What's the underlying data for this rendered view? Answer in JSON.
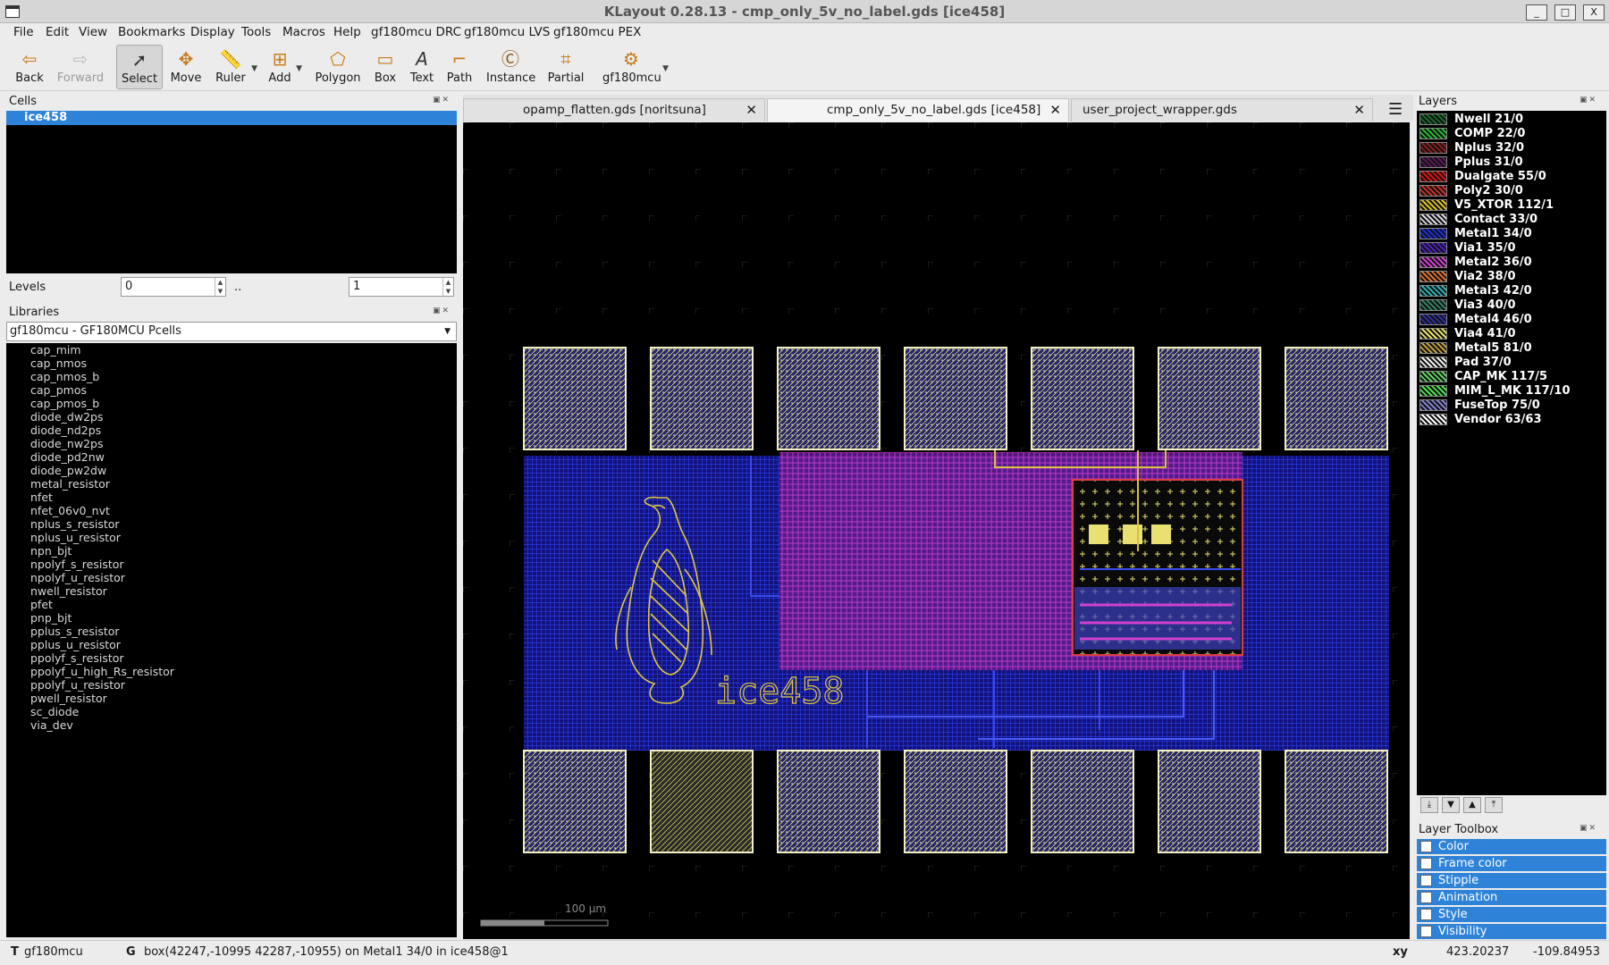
{
  "window": {
    "title": "KLayout 0.28.13 - cmp_only_5v_no_label.gds [ice458]"
  },
  "menu": [
    "File",
    "Edit",
    "View",
    "Bookmarks",
    "Display",
    "Tools",
    "Macros",
    "Help",
    "gf180mcu DRC",
    "gf180mcu LVS",
    "gf180mcu PEX"
  ],
  "toolbar": {
    "back": "Back",
    "forward": "Forward",
    "select": "Select",
    "move": "Move",
    "ruler": "Ruler",
    "add": "Add",
    "polygon": "Polygon",
    "box": "Box",
    "text": "Text",
    "path": "Path",
    "instance": "Instance",
    "partial": "Partial",
    "pdk": "gf180mcu"
  },
  "cells": {
    "title": "Cells",
    "selected": "ice458"
  },
  "levels": {
    "label": "Levels",
    "from": "0",
    "sep": "..",
    "to": "1"
  },
  "libraries": {
    "title": "Libraries",
    "selected": "gf180mcu - GF180MCU Pcells",
    "items": [
      "cap_mim",
      "cap_nmos",
      "cap_nmos_b",
      "cap_pmos",
      "cap_pmos_b",
      "diode_dw2ps",
      "diode_nd2ps",
      "diode_nw2ps",
      "diode_pd2nw",
      "diode_pw2dw",
      "metal_resistor",
      "nfet",
      "nfet_06v0_nvt",
      "nplus_s_resistor",
      "nplus_u_resistor",
      "npn_bjt",
      "npolyf_s_resistor",
      "npolyf_u_resistor",
      "nwell_resistor",
      "pfet",
      "pnp_bjt",
      "pplus_s_resistor",
      "pplus_u_resistor",
      "ppolyf_s_resistor",
      "ppolyf_u_high_Rs_resistor",
      "ppolyf_u_resistor",
      "pwell_resistor",
      "sc_diode",
      "via_dev"
    ]
  },
  "tabs": [
    {
      "label": "opamp_flatten.gds [noritsuna]"
    },
    {
      "label": "cmp_only_5v_no_label.gds [ice458]"
    },
    {
      "label": "user_project_wrapper.gds [user_project_wrapper]"
    }
  ],
  "canvas": {
    "cell_label": "ice458",
    "scale_label": "100  µm"
  },
  "layers": {
    "title": "Layers",
    "items": [
      {
        "name": "Nwell 21/0",
        "color": "#1a6b2a"
      },
      {
        "name": "COMP 22/0",
        "color": "#2bb534"
      },
      {
        "name": "Nplus 32/0",
        "color": "#8a1f1f"
      },
      {
        "name": "Pplus 31/0",
        "color": "#5a1a5a"
      },
      {
        "name": "Dualgate 55/0",
        "color": "#e01010"
      },
      {
        "name": "Poly2 30/0",
        "color": "#c8302a"
      },
      {
        "name": "V5_XTOR 112/1",
        "color": "#d8c020"
      },
      {
        "name": "Contact 33/0",
        "color": "#d8d8e0"
      },
      {
        "name": "Metal1 34/0",
        "color": "#1d2ed8"
      },
      {
        "name": "Via1 35/0",
        "color": "#5020c0"
      },
      {
        "name": "Metal2 36/0",
        "color": "#d040d0"
      },
      {
        "name": "Via2 38/0",
        "color": "#e07030"
      },
      {
        "name": "Metal3 42/0",
        "color": "#30b0b0"
      },
      {
        "name": "Via3 40/0",
        "color": "#308060"
      },
      {
        "name": "Metal4 46/0",
        "color": "#3030a0"
      },
      {
        "name": "Via4 41/0",
        "color": "#e8e070"
      },
      {
        "name": "Metal5 81/0",
        "color": "#c0a040"
      },
      {
        "name": "Pad 37/0",
        "color": "#f0f0f0"
      },
      {
        "name": "CAP_MK 117/5",
        "color": "#60d060"
      },
      {
        "name": "MIM_L_MK 117/10",
        "color": "#50e050"
      },
      {
        "name": "FuseTop 75/0",
        "color": "#8080d0"
      },
      {
        "name": "Vendor 63/63",
        "color": "#ffffff"
      }
    ]
  },
  "toolbox": {
    "title": "Layer Toolbox",
    "items": [
      "Color",
      "Frame color",
      "Stipple",
      "Animation",
      "Style",
      "Visibility"
    ]
  },
  "status": {
    "mode": "T",
    "tech": "gf180mcu",
    "g": "G",
    "message": "box(42247,-10995 42287,-10955) on Metal1 34/0 in ice458@1",
    "xy": "xy",
    "x": "423.20237",
    "y": "-109.84953"
  }
}
